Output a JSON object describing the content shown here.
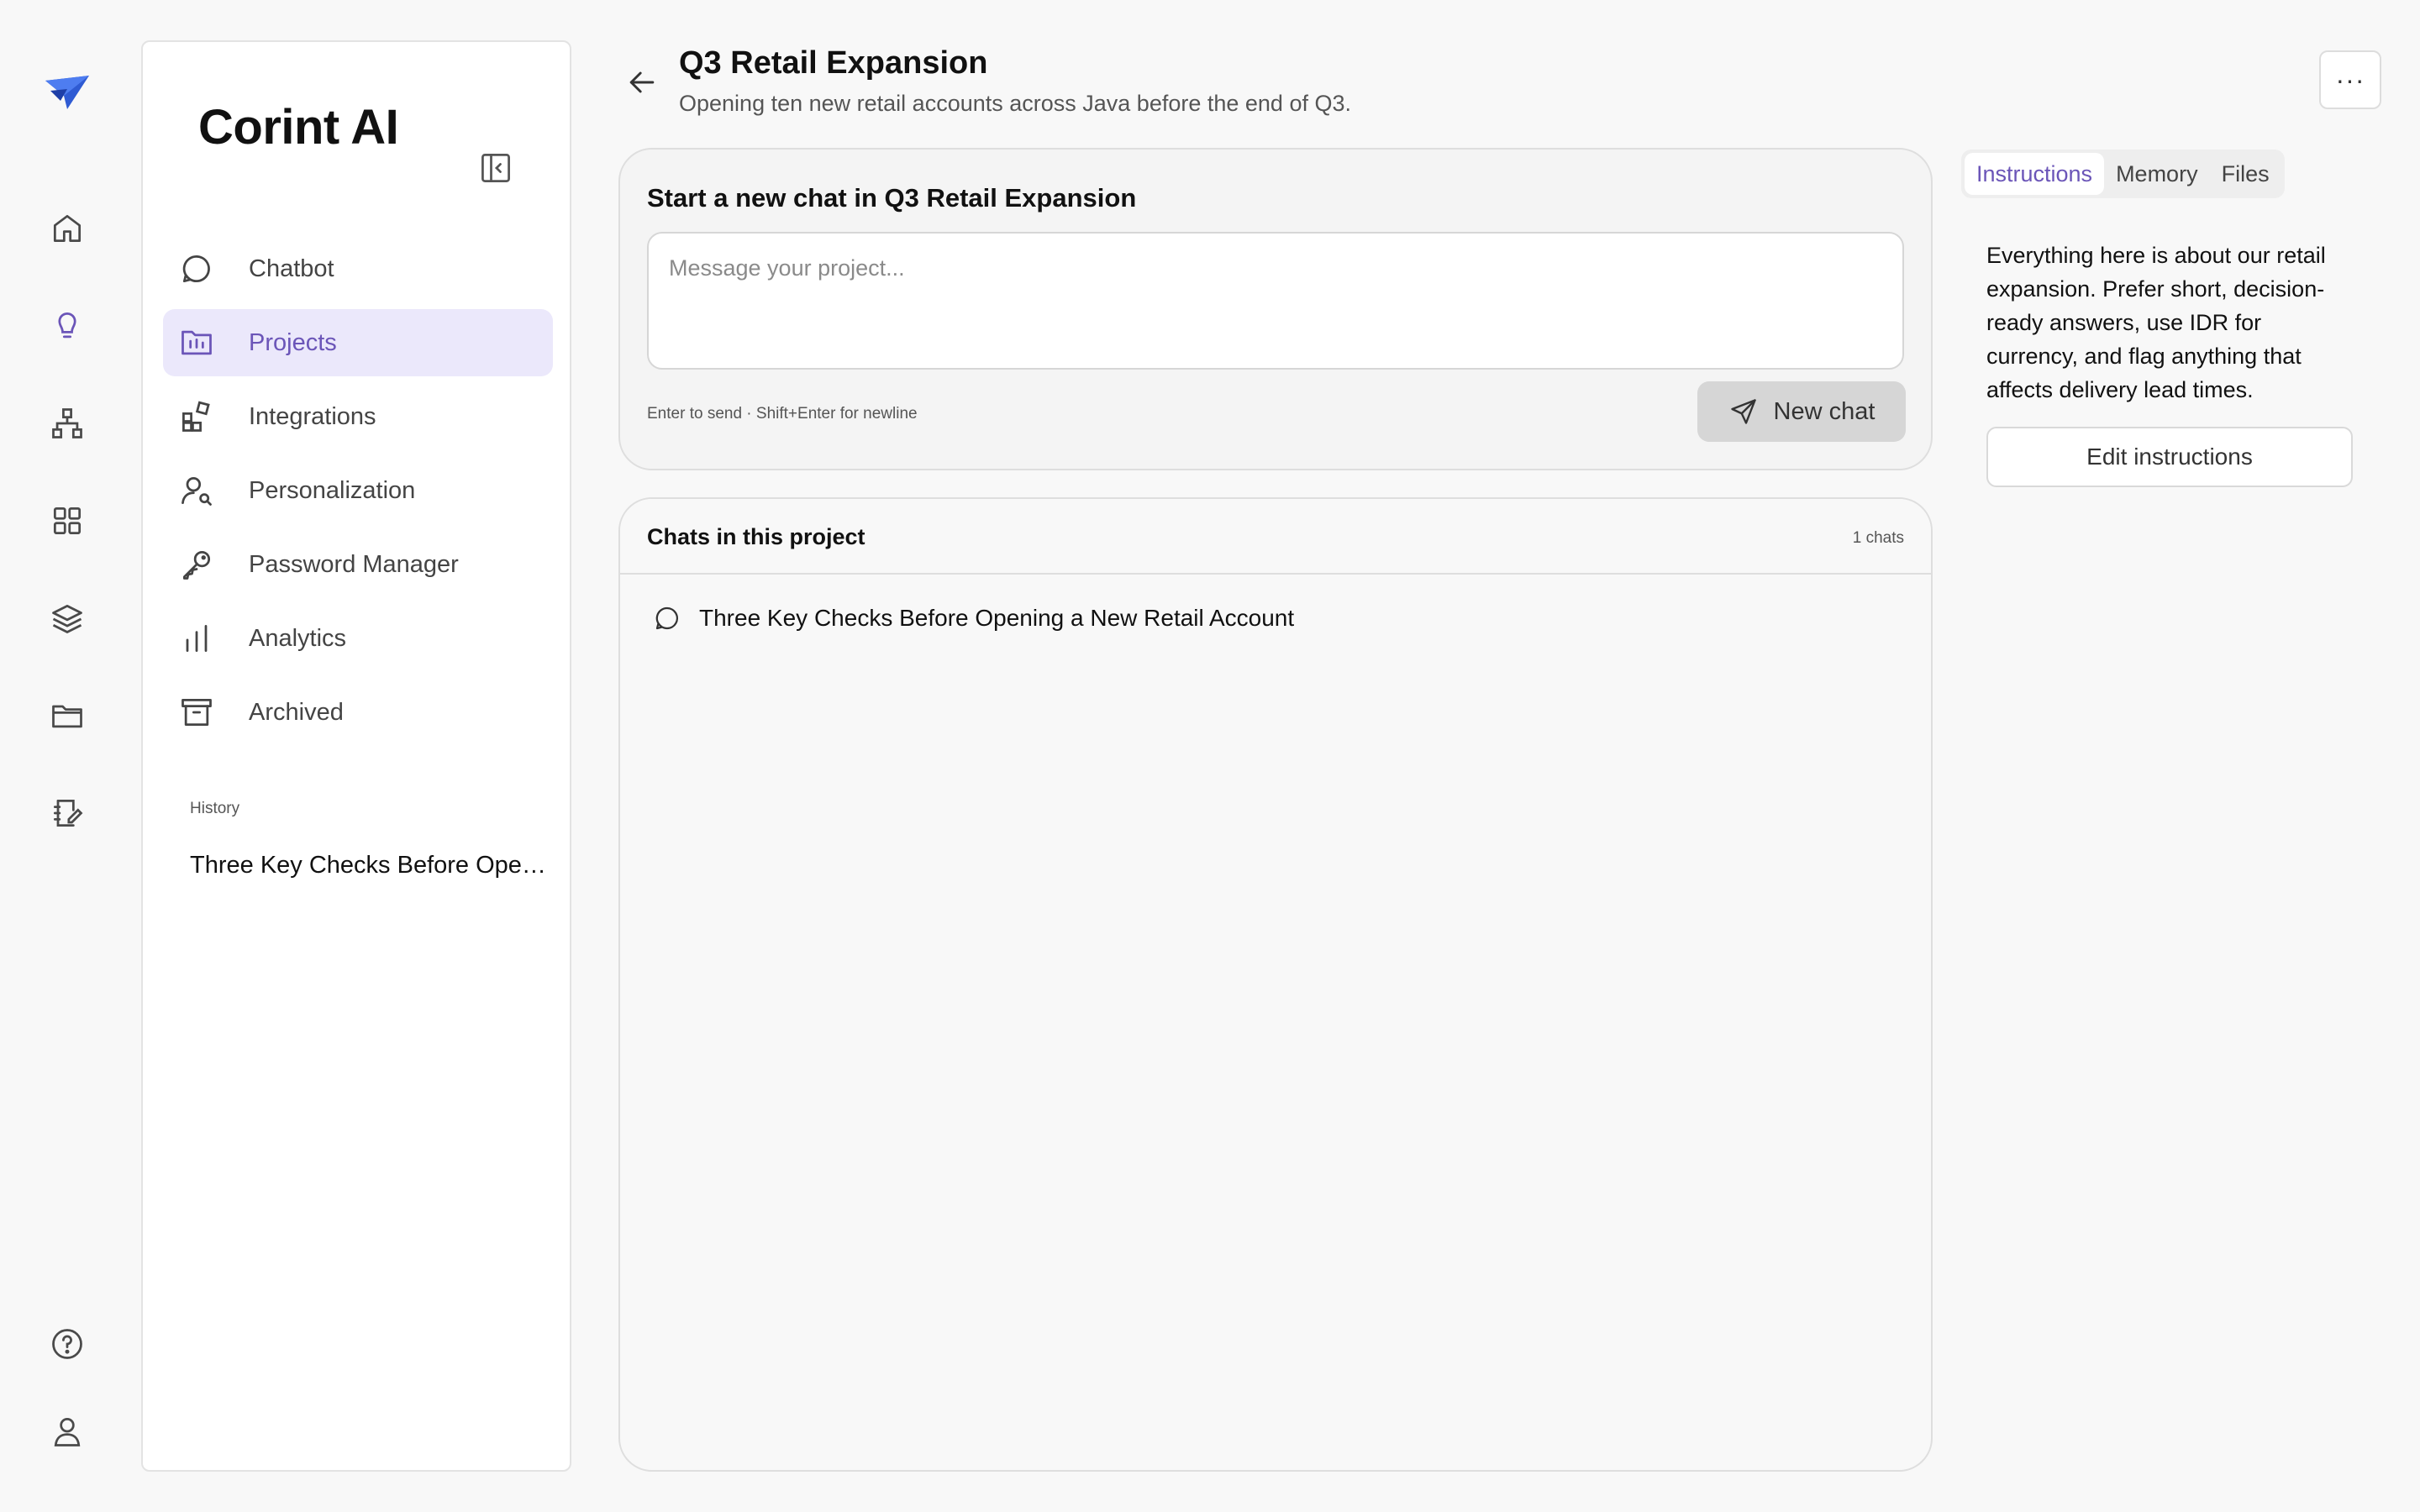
{
  "brand": {
    "name": "Corint AI"
  },
  "rail": {
    "top_icons": [
      "home-icon",
      "lightbulb-icon",
      "sitemap-icon",
      "grid-icon",
      "layers-icon",
      "folder-icon",
      "edit-notes-icon"
    ],
    "bottom_icons": [
      "help-icon",
      "user-icon"
    ],
    "active": "lightbulb-icon"
  },
  "sidebar": {
    "items": [
      {
        "label": "Chatbot",
        "icon": "chat-icon"
      },
      {
        "label": "Projects",
        "icon": "folder-chart-icon"
      },
      {
        "label": "Integrations",
        "icon": "integrations-icon"
      },
      {
        "label": "Personalization",
        "icon": "user-search-icon"
      },
      {
        "label": "Password Manager",
        "icon": "key-icon"
      },
      {
        "label": "Analytics",
        "icon": "bar-chart-icon"
      },
      {
        "label": "Archived",
        "icon": "archive-icon"
      }
    ],
    "active_item": "Projects",
    "history_label": "History",
    "history": [
      "Three Key Checks Before Opening a New Retail Account"
    ]
  },
  "header": {
    "title": "Q3 Retail Expansion",
    "subtitle": "Opening ten new retail accounts across Java before the end of Q3.",
    "more_label": "···"
  },
  "new_chat": {
    "title": "Start a new chat in Q3 Retail Expansion",
    "placeholder": "Message your project...",
    "hint": "Enter to send · Shift+Enter for newline",
    "button_label": "New chat"
  },
  "chats": {
    "title": "Chats in this project",
    "count": "1 chats",
    "items": [
      "Three Key Checks Before Opening a New Retail Account"
    ]
  },
  "right_panel": {
    "tabs": [
      "Instructions",
      "Memory",
      "Files"
    ],
    "active_tab": "Instructions",
    "instructions": "Everything here is about our retail expansion. Prefer short, decision-ready answers, use IDR for currency, and flag anything that affects delivery lead times.",
    "edit_button": "Edit instructions"
  },
  "colors": {
    "accent": "#6b55b8",
    "accent_bg": "#ebe8fb",
    "logo": "#2f5bd3"
  }
}
